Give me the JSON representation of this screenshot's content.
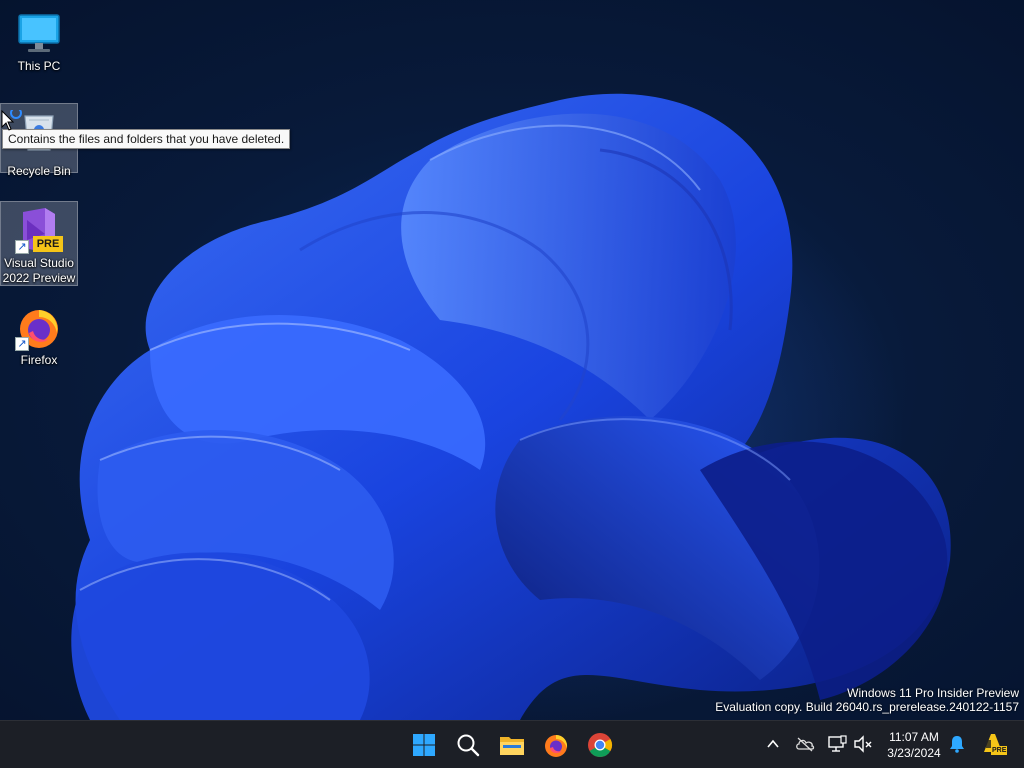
{
  "desktop": {
    "icons": [
      {
        "label": "This PC"
      },
      {
        "label": "Recycle Bin"
      },
      {
        "label_line1": "Visual Studio",
        "label_line2": "2022 Preview",
        "badge": "PRE"
      },
      {
        "label": "Firefox"
      }
    ],
    "tooltip": "Contains the files and folders that you have deleted.",
    "watermark": {
      "line1": "Windows 11 Pro Insider Preview",
      "line2": "Evaluation copy. Build 26040.rs_prerelease.240122-1157"
    }
  },
  "taskbar": {
    "apps": [
      {
        "icon": "windows-start-icon"
      },
      {
        "icon": "search-icon"
      },
      {
        "icon": "file-explorer-icon"
      },
      {
        "icon": "firefox-icon"
      },
      {
        "icon": "chrome-icon"
      }
    ],
    "tray": [
      {
        "icon": "chevron-up-icon"
      },
      {
        "icon": "onedrive-off-icon"
      },
      {
        "icon": "network-icon"
      },
      {
        "icon": "volume-muted-icon"
      }
    ],
    "clock": {
      "time": "11:07 AM",
      "date": "3/23/2024"
    },
    "pre_badge": "PRE"
  },
  "colors": {
    "taskbar_bg": "#1c1f26",
    "wallpaper_blue": "#1e54ff",
    "windows_blue": "#2ea8ff"
  }
}
